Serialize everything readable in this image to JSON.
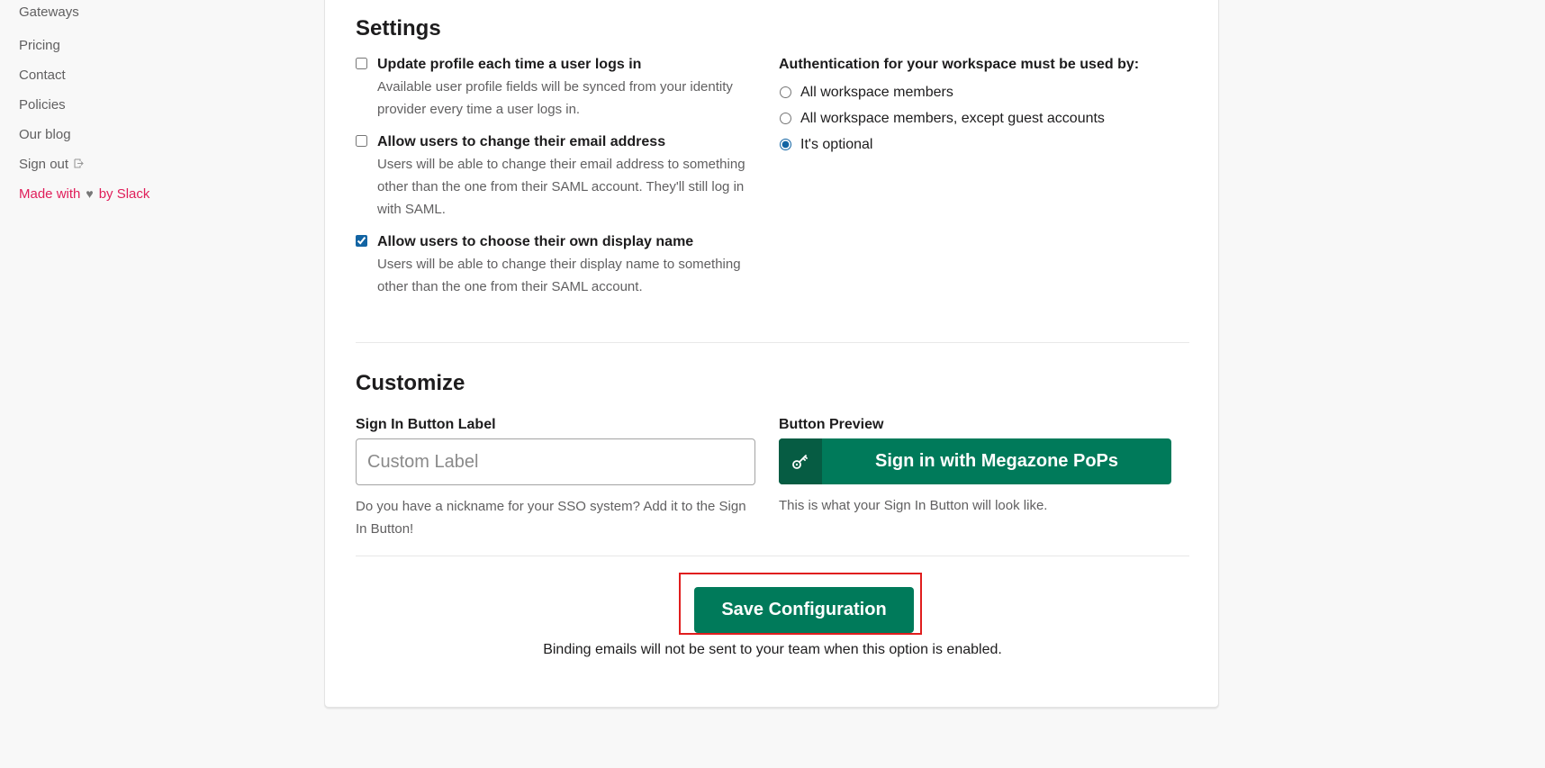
{
  "sidebar": {
    "links": [
      "Gateways",
      "Pricing",
      "Contact",
      "Policies",
      "Our blog",
      "Sign out"
    ],
    "signout_icon": "external-link-icon",
    "made_with": "Made with",
    "by_slack": "by Slack",
    "heart_icon": "heart-icon"
  },
  "settings": {
    "title": "Settings",
    "options": [
      {
        "label": "Update profile each time a user logs in",
        "description": "Available user profile fields will be synced from your identity provider every time a user logs in.",
        "checked": false
      },
      {
        "label": "Allow users to change their email address",
        "description": "Users will be able to change their email address to something other than the one from their SAML account. They'll still log in with SAML.",
        "checked": false
      },
      {
        "label": "Allow users to choose their own display name",
        "description": "Users will be able to change their display name to something other than the one from their SAML account.",
        "checked": true
      }
    ],
    "auth": {
      "title": "Authentication for your workspace must be used by:",
      "choices": [
        "All workspace members",
        "All workspace members, except guest accounts",
        "It's optional"
      ],
      "selected": "It's optional"
    }
  },
  "customize": {
    "title": "Customize",
    "sign_in_label": "Sign In Button Label",
    "input_value": "",
    "input_placeholder": "Custom Label",
    "input_hint": "Do you have a nickname for your SSO system? Add it to the Sign In Button!",
    "preview_title": "Button Preview",
    "preview_button": "Sign in with Megazone PoPs",
    "preview_icon": "key-icon",
    "preview_hint": "This is what your Sign In Button will look like."
  },
  "save": {
    "button": "Save Configuration",
    "note": "Binding emails will not be sent to your team when this option is enabled."
  },
  "colors": {
    "brand_green": "#007a5a",
    "link_pink": "#e01e5a",
    "highlight_red": "#e01e1e"
  }
}
